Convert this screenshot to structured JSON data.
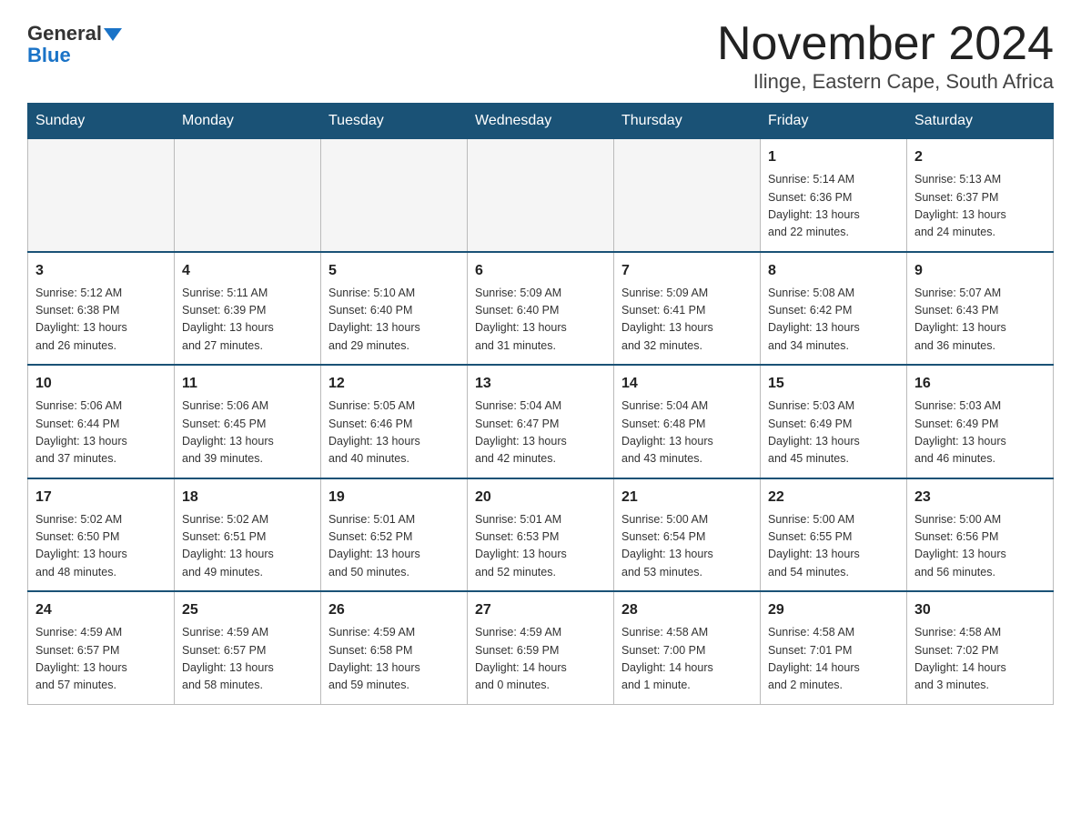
{
  "header": {
    "logo_general": "General",
    "logo_blue": "Blue",
    "title": "November 2024",
    "subtitle": "Ilinge, Eastern Cape, South Africa"
  },
  "weekdays": [
    "Sunday",
    "Monday",
    "Tuesday",
    "Wednesday",
    "Thursday",
    "Friday",
    "Saturday"
  ],
  "weeks": [
    {
      "days": [
        {
          "num": "",
          "info": "",
          "empty": true
        },
        {
          "num": "",
          "info": "",
          "empty": true
        },
        {
          "num": "",
          "info": "",
          "empty": true
        },
        {
          "num": "",
          "info": "",
          "empty": true
        },
        {
          "num": "",
          "info": "",
          "empty": true
        },
        {
          "num": "1",
          "info": "Sunrise: 5:14 AM\nSunset: 6:36 PM\nDaylight: 13 hours\nand 22 minutes."
        },
        {
          "num": "2",
          "info": "Sunrise: 5:13 AM\nSunset: 6:37 PM\nDaylight: 13 hours\nand 24 minutes."
        }
      ]
    },
    {
      "days": [
        {
          "num": "3",
          "info": "Sunrise: 5:12 AM\nSunset: 6:38 PM\nDaylight: 13 hours\nand 26 minutes."
        },
        {
          "num": "4",
          "info": "Sunrise: 5:11 AM\nSunset: 6:39 PM\nDaylight: 13 hours\nand 27 minutes."
        },
        {
          "num": "5",
          "info": "Sunrise: 5:10 AM\nSunset: 6:40 PM\nDaylight: 13 hours\nand 29 minutes."
        },
        {
          "num": "6",
          "info": "Sunrise: 5:09 AM\nSunset: 6:40 PM\nDaylight: 13 hours\nand 31 minutes."
        },
        {
          "num": "7",
          "info": "Sunrise: 5:09 AM\nSunset: 6:41 PM\nDaylight: 13 hours\nand 32 minutes."
        },
        {
          "num": "8",
          "info": "Sunrise: 5:08 AM\nSunset: 6:42 PM\nDaylight: 13 hours\nand 34 minutes."
        },
        {
          "num": "9",
          "info": "Sunrise: 5:07 AM\nSunset: 6:43 PM\nDaylight: 13 hours\nand 36 minutes."
        }
      ]
    },
    {
      "days": [
        {
          "num": "10",
          "info": "Sunrise: 5:06 AM\nSunset: 6:44 PM\nDaylight: 13 hours\nand 37 minutes."
        },
        {
          "num": "11",
          "info": "Sunrise: 5:06 AM\nSunset: 6:45 PM\nDaylight: 13 hours\nand 39 minutes."
        },
        {
          "num": "12",
          "info": "Sunrise: 5:05 AM\nSunset: 6:46 PM\nDaylight: 13 hours\nand 40 minutes."
        },
        {
          "num": "13",
          "info": "Sunrise: 5:04 AM\nSunset: 6:47 PM\nDaylight: 13 hours\nand 42 minutes."
        },
        {
          "num": "14",
          "info": "Sunrise: 5:04 AM\nSunset: 6:48 PM\nDaylight: 13 hours\nand 43 minutes."
        },
        {
          "num": "15",
          "info": "Sunrise: 5:03 AM\nSunset: 6:49 PM\nDaylight: 13 hours\nand 45 minutes."
        },
        {
          "num": "16",
          "info": "Sunrise: 5:03 AM\nSunset: 6:49 PM\nDaylight: 13 hours\nand 46 minutes."
        }
      ]
    },
    {
      "days": [
        {
          "num": "17",
          "info": "Sunrise: 5:02 AM\nSunset: 6:50 PM\nDaylight: 13 hours\nand 48 minutes."
        },
        {
          "num": "18",
          "info": "Sunrise: 5:02 AM\nSunset: 6:51 PM\nDaylight: 13 hours\nand 49 minutes."
        },
        {
          "num": "19",
          "info": "Sunrise: 5:01 AM\nSunset: 6:52 PM\nDaylight: 13 hours\nand 50 minutes."
        },
        {
          "num": "20",
          "info": "Sunrise: 5:01 AM\nSunset: 6:53 PM\nDaylight: 13 hours\nand 52 minutes."
        },
        {
          "num": "21",
          "info": "Sunrise: 5:00 AM\nSunset: 6:54 PM\nDaylight: 13 hours\nand 53 minutes."
        },
        {
          "num": "22",
          "info": "Sunrise: 5:00 AM\nSunset: 6:55 PM\nDaylight: 13 hours\nand 54 minutes."
        },
        {
          "num": "23",
          "info": "Sunrise: 5:00 AM\nSunset: 6:56 PM\nDaylight: 13 hours\nand 56 minutes."
        }
      ]
    },
    {
      "days": [
        {
          "num": "24",
          "info": "Sunrise: 4:59 AM\nSunset: 6:57 PM\nDaylight: 13 hours\nand 57 minutes."
        },
        {
          "num": "25",
          "info": "Sunrise: 4:59 AM\nSunset: 6:57 PM\nDaylight: 13 hours\nand 58 minutes."
        },
        {
          "num": "26",
          "info": "Sunrise: 4:59 AM\nSunset: 6:58 PM\nDaylight: 13 hours\nand 59 minutes."
        },
        {
          "num": "27",
          "info": "Sunrise: 4:59 AM\nSunset: 6:59 PM\nDaylight: 14 hours\nand 0 minutes."
        },
        {
          "num": "28",
          "info": "Sunrise: 4:58 AM\nSunset: 7:00 PM\nDaylight: 14 hours\nand 1 minute."
        },
        {
          "num": "29",
          "info": "Sunrise: 4:58 AM\nSunset: 7:01 PM\nDaylight: 14 hours\nand 2 minutes."
        },
        {
          "num": "30",
          "info": "Sunrise: 4:58 AM\nSunset: 7:02 PM\nDaylight: 14 hours\nand 3 minutes."
        }
      ]
    }
  ]
}
